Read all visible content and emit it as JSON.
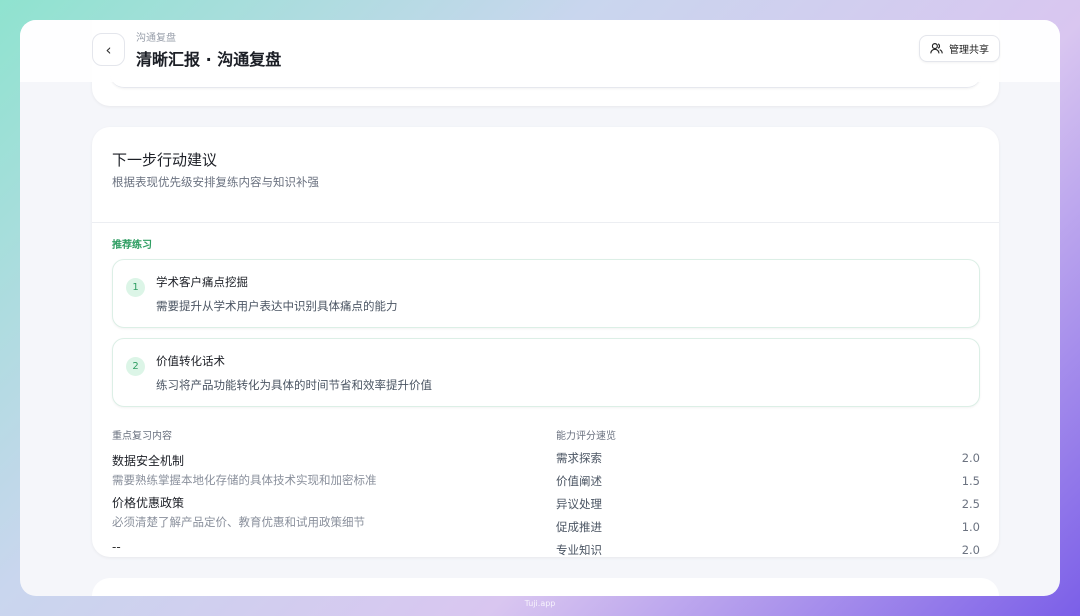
{
  "header": {
    "breadcrumb": "沟通复盘",
    "title": "清晰汇报 · 沟通复盘",
    "share_label": "管理共享"
  },
  "section": {
    "title": "下一步行动建议",
    "subtitle": "根据表现优先级安排复练内容与知识补强",
    "recommended_label": "推荐练习",
    "practices": [
      {
        "num": "1",
        "title": "学术客户痛点挖掘",
        "desc": "需要提升从学术用户表达中识别具体痛点的能力"
      },
      {
        "num": "2",
        "title": "价值转化话术",
        "desc": "练习将产品功能转化为具体的时间节省和效率提升价值"
      }
    ],
    "review_label": "重点复习内容",
    "review": [
      {
        "title": "数据安全机制",
        "desc": "需要熟练掌握本地化存储的具体技术实现和加密标准"
      },
      {
        "title": "价格优惠政策",
        "desc": "必须清楚了解产品定价、教育优惠和试用政策细节"
      }
    ],
    "review_extra": "--",
    "ratings_label": "能力评分速览",
    "ratings": [
      {
        "name": "需求探索",
        "score": "2.0"
      },
      {
        "name": "价值阐述",
        "score": "1.5"
      },
      {
        "name": "异议处理",
        "score": "2.5"
      },
      {
        "name": "促成推进",
        "score": "1.0"
      },
      {
        "name": "专业知识",
        "score": "2.0"
      }
    ]
  },
  "footer": {
    "watermark": "Tuji.app"
  },
  "colors": {
    "accent": "#2f9e63"
  }
}
